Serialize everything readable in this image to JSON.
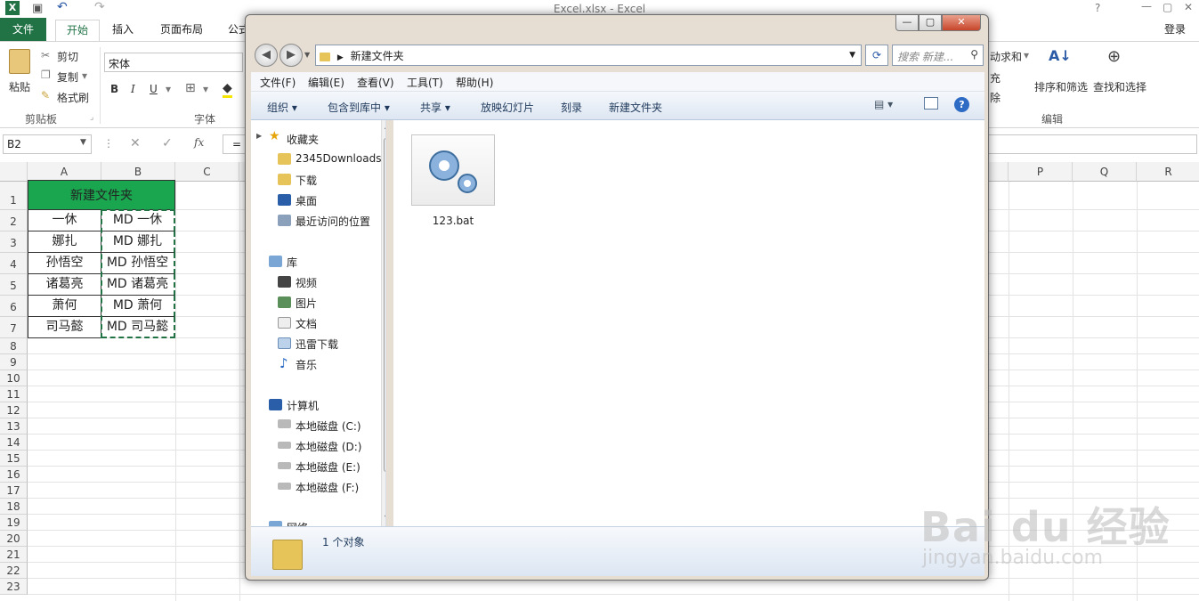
{
  "excel": {
    "window_title": "Excel.xlsx - Excel",
    "login": "登录",
    "tabs": [
      "文件",
      "开始",
      "插入",
      "页面布局",
      "公式"
    ],
    "ribbon": {
      "clipboard": {
        "paste": "粘贴",
        "cut": "剪切",
        "copy": "复制",
        "format_painter": "格式刷",
        "group": "剪贴板"
      },
      "font": {
        "name": "宋体",
        "group": "字体",
        "bold": "B",
        "italic": "I",
        "underline": "U"
      },
      "right_partial": {
        "sum": "动求和",
        "fill": "充",
        "clear": "除"
      },
      "editing": {
        "sort_filter": "排序和筛选",
        "find_select": "查找和选择",
        "group": "编辑"
      }
    },
    "name_box": "B2",
    "formula_prefix": "=",
    "columns": [
      "A",
      "B",
      "C",
      "P",
      "Q",
      "R"
    ],
    "rows": [
      "1",
      "2",
      "3",
      "4",
      "5",
      "6",
      "7",
      "8",
      "9",
      "10",
      "11",
      "12",
      "13",
      "14",
      "15",
      "16",
      "17",
      "18",
      "19",
      "20",
      "21",
      "22",
      "23"
    ],
    "header_cell": "新建文件夹",
    "col_a": [
      "一休",
      "娜扎",
      "孙悟空",
      "诸葛亮",
      "萧何",
      "司马懿"
    ],
    "col_b": [
      "MD 一休",
      "MD 娜扎",
      "MD 孙悟空",
      "MD 诸葛亮",
      "MD 萧何",
      "MD 司马懿"
    ]
  },
  "explorer": {
    "address": "新建文件夹",
    "search_placeholder": "搜索 新建...",
    "menu": [
      "文件(F)",
      "编辑(E)",
      "查看(V)",
      "工具(T)",
      "帮助(H)"
    ],
    "commands": [
      "组织 ▾",
      "包含到库中 ▾",
      "共享 ▾",
      "放映幻灯片",
      "刻录",
      "新建文件夹"
    ],
    "nav": {
      "favorites": "收藏夹",
      "favorites_items": [
        "2345Downloads",
        "下载",
        "桌面",
        "最近访问的位置"
      ],
      "library": "库",
      "library_items": [
        "视频",
        "图片",
        "文档",
        "迅雷下载",
        "音乐"
      ],
      "computer": "计算机",
      "drives": [
        "本地磁盘 (C:)",
        "本地磁盘 (D:)",
        "本地磁盘 (E:)",
        "本地磁盘 (F:)"
      ],
      "network": "网络"
    },
    "file": "123.bat",
    "status": "1 个对象",
    "controls": {
      "minimize": "—",
      "maximize": "▢",
      "close": "✕"
    }
  },
  "watermark": {
    "brand": "Bai du 经验",
    "url": "jingyan.baidu.com"
  },
  "colors": {
    "excel_green": "#217346",
    "header_fill": "#1aa64f"
  }
}
